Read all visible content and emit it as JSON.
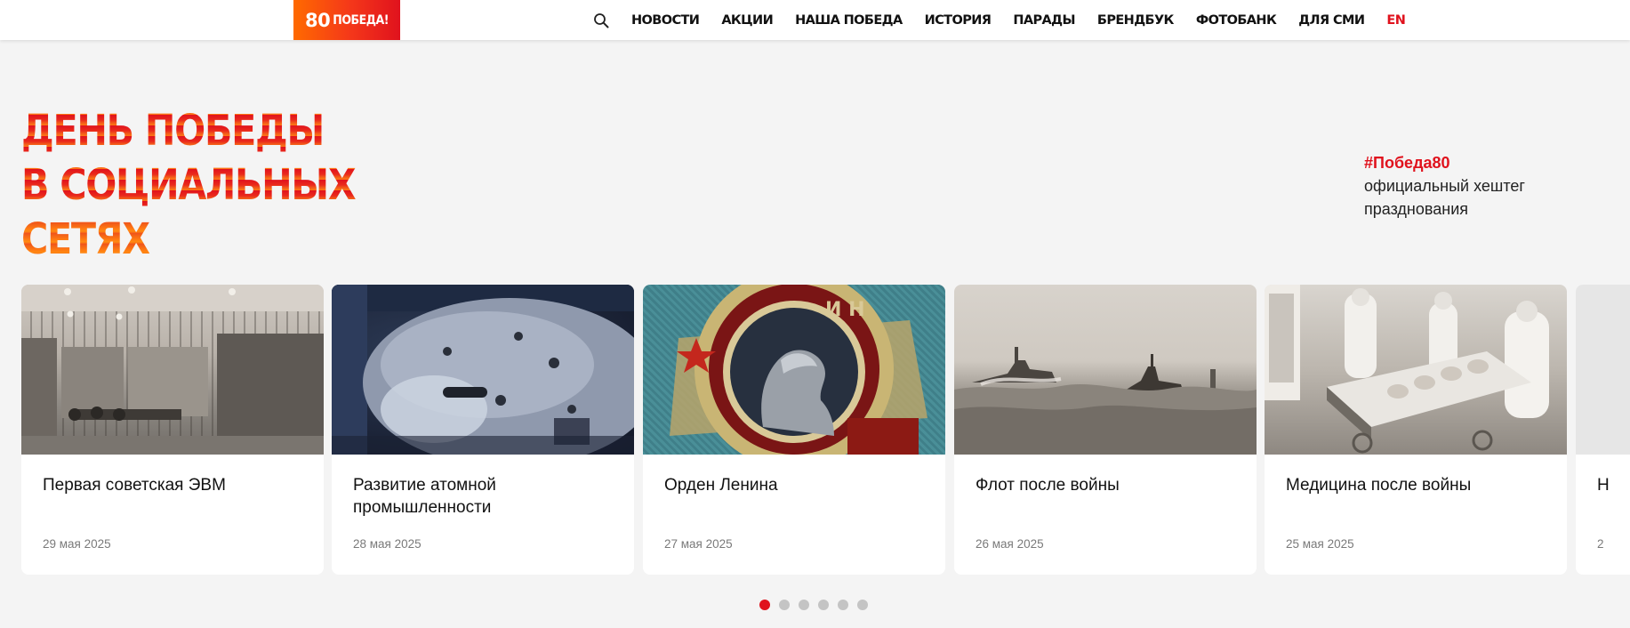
{
  "header": {
    "logo_number": "80",
    "logo_word": "ПОБЕДА!",
    "nav": [
      {
        "label": "НОВОСТИ"
      },
      {
        "label": "АКЦИИ"
      },
      {
        "label": "НАША ПОБЕДА"
      },
      {
        "label": "ИСТОРИЯ"
      },
      {
        "label": "ПАРАДЫ"
      },
      {
        "label": "БРЕНДБУК"
      },
      {
        "label": "ФОТОБАНК"
      },
      {
        "label": "ДЛЯ СМИ"
      }
    ],
    "lang": "EN"
  },
  "hero": {
    "title_lines": [
      "ДЕНЬ ПОБЕДЫ",
      "В СОЦИАЛЬНЫХ",
      "СЕТЯХ"
    ],
    "hashtag": "#Победа80",
    "hashtag_desc": "официальный хештег празднования"
  },
  "cards": [
    {
      "title": "Первая советская ЭВМ",
      "date": "29 мая 2025"
    },
    {
      "title": "Развитие атомной промышленности",
      "date": "28 мая 2025"
    },
    {
      "title": "Орден Ленина",
      "date": "27 мая 2025"
    },
    {
      "title": "Флот после войны",
      "date": "26 мая 2025"
    },
    {
      "title": "Медицина после войны",
      "date": "25 мая 2025"
    },
    {
      "title": "Н",
      "date": "2"
    }
  ],
  "colors": {
    "accent": "#e0121d",
    "accent_orange": "#ff7a12",
    "background": "#f4f4f4"
  },
  "pagination": {
    "count": 6,
    "active_index": 0
  }
}
